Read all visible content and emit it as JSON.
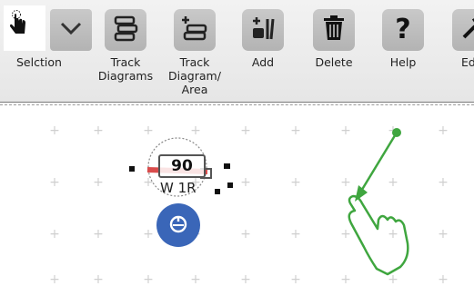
{
  "toolbar": {
    "items": [
      {
        "label": "Selction",
        "icon": "hand-cursor-icon"
      },
      {
        "label": "",
        "icon": "chevron-down-icon"
      },
      {
        "label": "Track\nDiagrams",
        "icon": "track-diagrams-icon"
      },
      {
        "label": "Track\nDiagram/\nArea",
        "icon": "track-diagram-area-icon"
      },
      {
        "label": "Add",
        "icon": "add-track-icon"
      },
      {
        "label": "Delete",
        "icon": "trash-icon"
      },
      {
        "label": "Help",
        "icon": "help-icon"
      },
      {
        "label": "Ed",
        "icon": "edit-wrench-icon"
      }
    ]
  },
  "canvas": {
    "turnout": {
      "address": "90",
      "name": "W 1R"
    },
    "colors": {
      "accent_red": "#d94c4c",
      "badge_blue": "#3a66b8",
      "gesture_green": "#3fa63f",
      "grid_plus": "#cfcfcf"
    }
  }
}
